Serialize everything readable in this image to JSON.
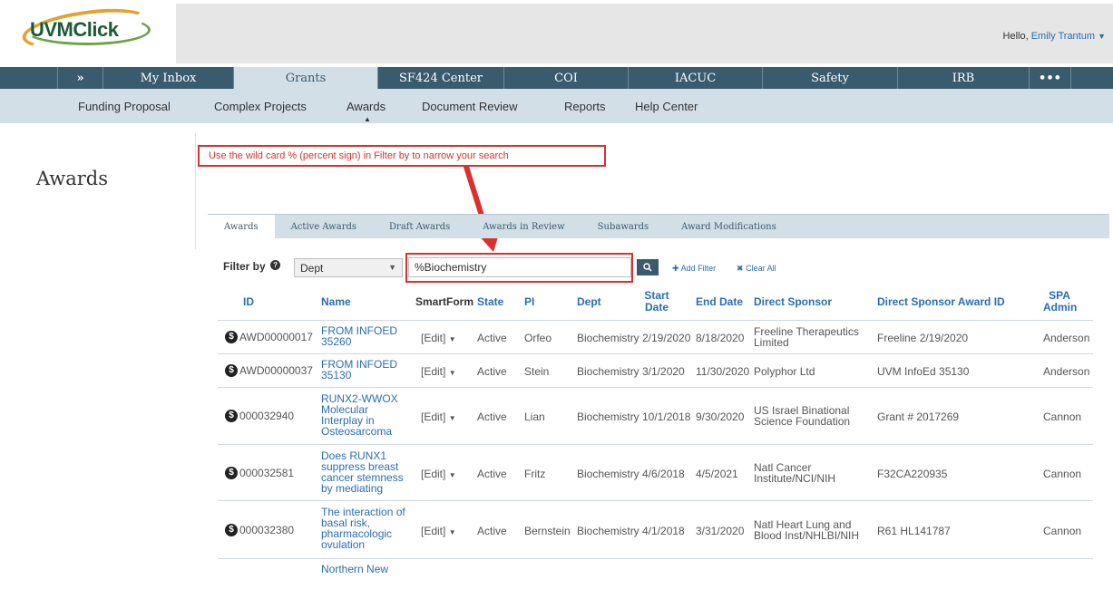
{
  "header": {
    "logo": "UVMClick",
    "hello_prefix": "Hello,",
    "user_name": "Emily Trantum"
  },
  "main_nav": {
    "expand": "»",
    "items": [
      "My Inbox",
      "Grants",
      "SF424 Center",
      "COI",
      "IACUC",
      "Safety",
      "IRB"
    ],
    "active": "Grants",
    "more": "•••"
  },
  "sub_nav": {
    "items": [
      "Funding Proposal",
      "Complex Projects",
      "Awards",
      "Document Review",
      "Reports",
      "Help Center"
    ],
    "active": "Awards"
  },
  "page": {
    "title": "Awards"
  },
  "annotation": {
    "text": "Use the wild card % (percent sign) in Filter by to narrow your search"
  },
  "tabs": [
    "Awards",
    "Active Awards",
    "Draft Awards",
    "Awards in Review",
    "Subawards",
    "Award Modifications"
  ],
  "filter": {
    "label": "Filter by",
    "field": "Dept",
    "value": "%Biochemistry",
    "add_filter": "Add Filter",
    "clear_all": "Clear All"
  },
  "table": {
    "headers": {
      "id": "ID",
      "name": "Name",
      "smartform": "SmartForm",
      "state": "State",
      "pi": "PI",
      "dept": "Dept",
      "start_date_1": "Start",
      "start_date_2": "Date",
      "end_date": "End Date",
      "direct_sponsor": "Direct Sponsor",
      "sponsor_award_id": "Direct Sponsor Award ID",
      "spa_admin_1": "SPA",
      "spa_admin_2": "Admin"
    },
    "rows": [
      {
        "id": "AWD00000017",
        "name": [
          "FROM INFOED",
          "35260"
        ],
        "smartform": "[Edit]",
        "state": "Active",
        "pi": "Orfeo",
        "dept": "Biochemistry",
        "start": "2/19/2020",
        "end": "8/18/2020",
        "sponsor": [
          "Freeline Therapeutics",
          "Limited"
        ],
        "sponsor_award_id": "Freeline 2/19/2020",
        "spa_admin": "Anderson"
      },
      {
        "id": "AWD00000037",
        "name": [
          "FROM INFOED",
          "35130"
        ],
        "smartform": "[Edit]",
        "state": "Active",
        "pi": "Stein",
        "dept": "Biochemistry",
        "start": "3/1/2020",
        "end": "11/30/2020",
        "sponsor": [
          "Polyphor Ltd"
        ],
        "sponsor_award_id": "UVM InfoEd 35130",
        "spa_admin": "Anderson"
      },
      {
        "id": "000032940",
        "name": [
          "RUNX2-WWOX",
          "Molecular",
          "Interplay in",
          "Osteosarcoma"
        ],
        "smartform": "[Edit]",
        "state": "Active",
        "pi": "Lian",
        "dept": "Biochemistry",
        "start": "10/1/2018",
        "end": "9/30/2020",
        "sponsor": [
          "US Israel Binational",
          "Science Foundation"
        ],
        "sponsor_award_id": "Grant # 2017269",
        "spa_admin": "Cannon"
      },
      {
        "id": "000032581",
        "name": [
          "Does RUNX1",
          "suppress breast",
          "cancer stemness",
          "by mediating"
        ],
        "smartform": "[Edit]",
        "state": "Active",
        "pi": "Fritz",
        "dept": "Biochemistry",
        "start": "4/6/2018",
        "end": "4/5/2021",
        "sponsor": [
          "Natl Cancer",
          "Institute/NCI/NIH"
        ],
        "sponsor_award_id": "F32CA220935",
        "spa_admin": "Cannon"
      },
      {
        "id": "000032380",
        "name": [
          "The interaction of",
          "basal risk,",
          "pharmacologic",
          "ovulation"
        ],
        "smartform": "[Edit]",
        "state": "Active",
        "pi": "Bernstein",
        "dept": "Biochemistry",
        "start": "4/1/2018",
        "end": "3/31/2020",
        "sponsor": [
          "Natl Heart Lung and",
          "Blood Inst/NHLBI/NIH"
        ],
        "sponsor_award_id": "R61 HL141787",
        "spa_admin": "Cannon"
      },
      {
        "name": [
          "Northern New"
        ]
      }
    ]
  },
  "colors": {
    "nav_bg": "#3a5a6e",
    "subnav_bg": "#d2dfe7",
    "link": "#2a6db3",
    "annotation_red": "#d8312f"
  }
}
